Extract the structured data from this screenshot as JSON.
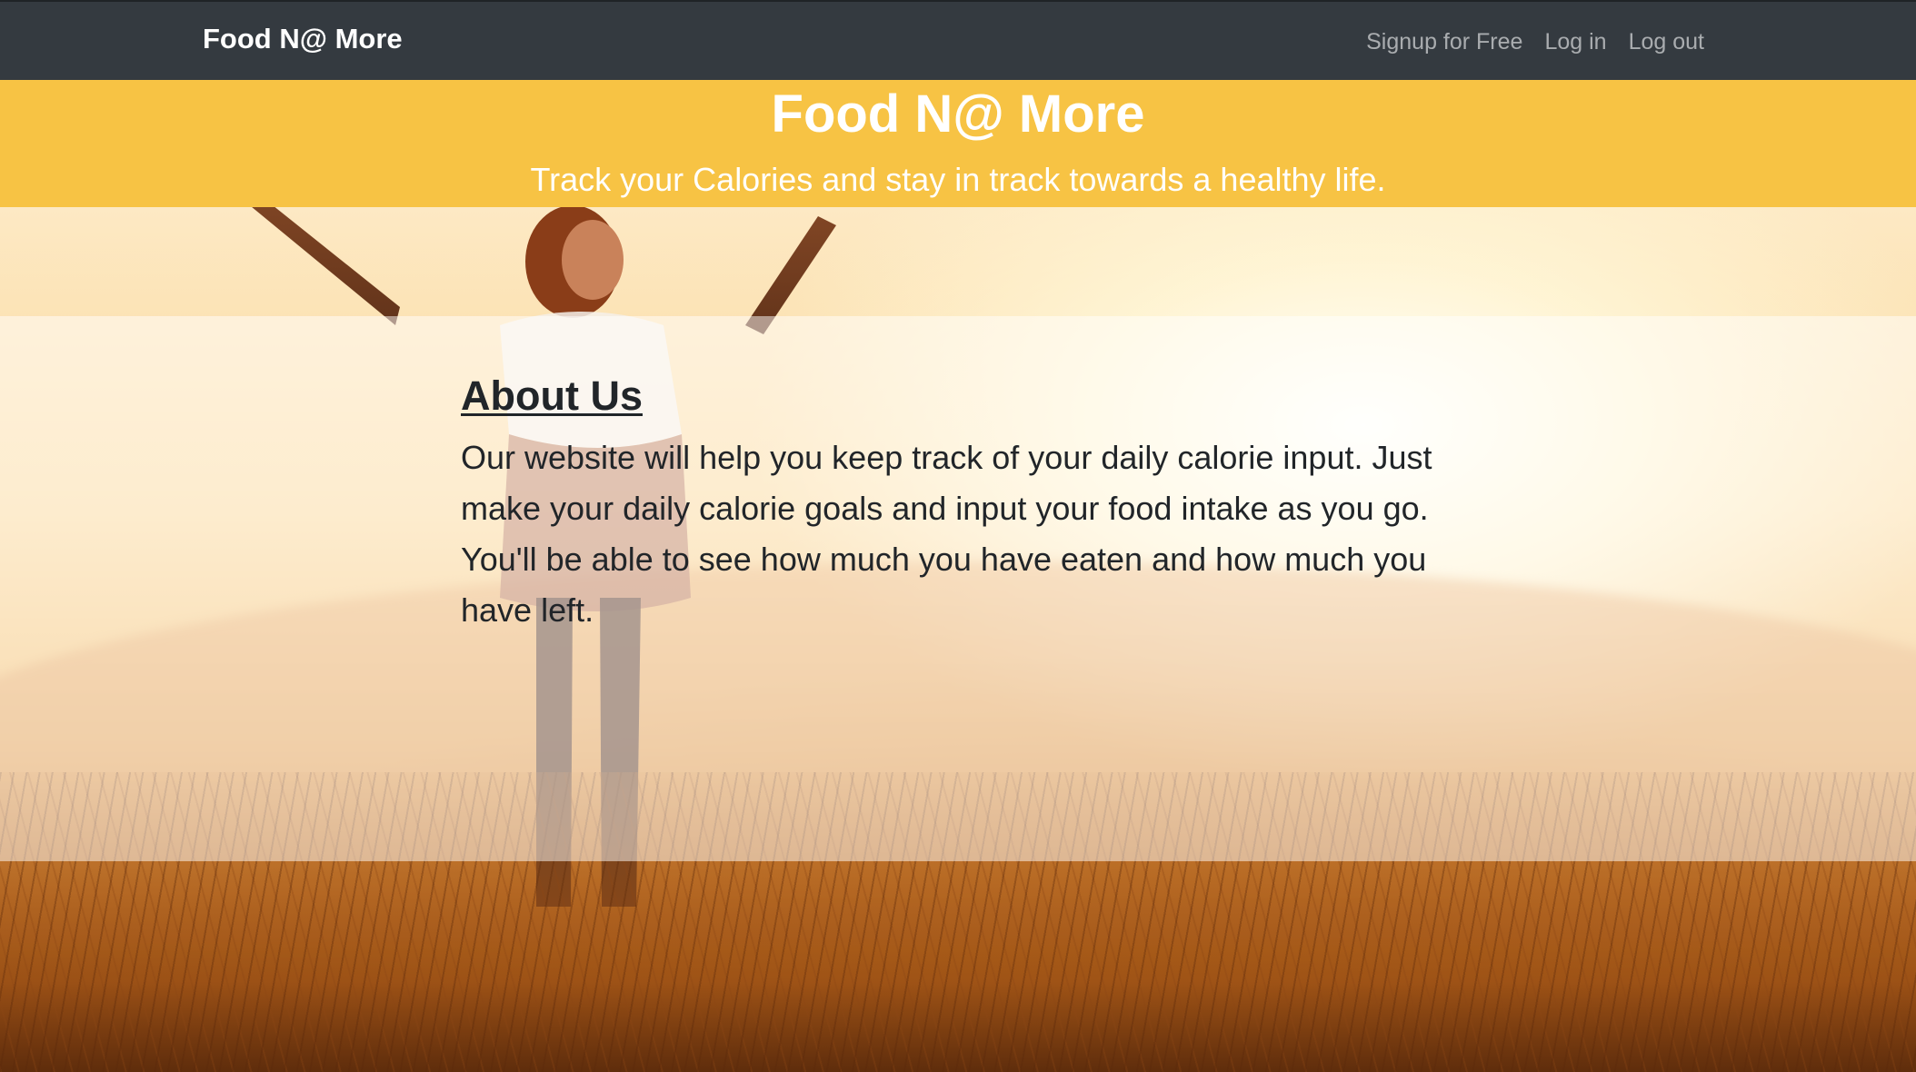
{
  "navbar": {
    "brand": "Food N@ More",
    "links": [
      "Signup for Free",
      "Log in",
      "Log out"
    ]
  },
  "banner": {
    "title": "Food N@ More",
    "subtitle": "Track your Calories and stay in track towards a healthy life."
  },
  "about": {
    "title": "About Us",
    "text": "Our website will help you keep track of your daily calorie input. Just make your daily calorie goals and input your food intake as you go. You'll be able to see how much you have eaten and how much you have left."
  },
  "colors": {
    "navbar_bg": "#343a40",
    "banner_bg": "#f7c344",
    "text_dark": "#212529"
  }
}
